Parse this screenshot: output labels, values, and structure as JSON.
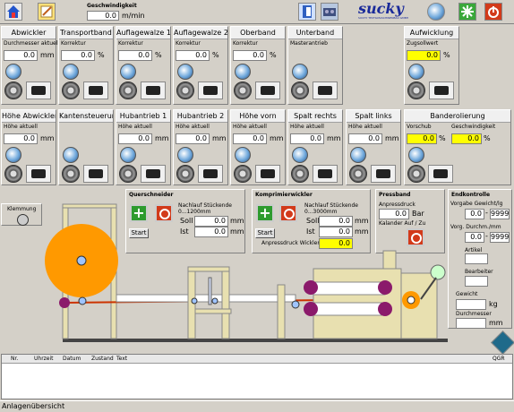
{
  "toolbar": {
    "speed_label": "Geschwindigkeit",
    "speed_value": "0.0",
    "speed_unit": "m/min",
    "logo_text": "sucky",
    "logo_sub": "SUCHY TEXTILMASCHINENBAU GMBH"
  },
  "row1": [
    {
      "title": "Abwickler",
      "sub": "Durchmesser aktuell",
      "value": "0.0",
      "unit": "mm",
      "yellow": false
    },
    {
      "title": "Transportband",
      "sub": "Korrektur",
      "value": "0.0",
      "unit": "%",
      "yellow": false
    },
    {
      "title": "Auflagewalze 1",
      "sub": "Korrektur",
      "value": "0.0",
      "unit": "%",
      "yellow": false
    },
    {
      "title": "Auflagewalze 2",
      "sub": "Korrektur",
      "value": "0.0",
      "unit": "%",
      "yellow": false
    },
    {
      "title": "Oberband",
      "sub": "Korrektur",
      "value": "0.0",
      "unit": "%",
      "yellow": false
    },
    {
      "title": "Unterband",
      "sub": "Masterantrieb",
      "value": "",
      "unit": "",
      "yellow": false
    },
    {
      "title": "Aufwicklung",
      "sub": "Zugsollwert",
      "value": "0.0",
      "unit": "%",
      "yellow": true
    }
  ],
  "row2": [
    {
      "title": "Höhe Abwickler",
      "sub": "Höhe aktuell",
      "value": "0.0",
      "unit": "mm"
    },
    {
      "title": "Kantensteuerung",
      "sub": "",
      "value": "",
      "unit": ""
    },
    {
      "title": "Hubantrieb 1",
      "sub": "Höhe aktuell",
      "value": "0.0",
      "unit": "mm"
    },
    {
      "title": "Hubantrieb 2",
      "sub": "Höhe aktuell",
      "value": "0.0",
      "unit": "mm"
    },
    {
      "title": "Höhe vorn",
      "sub": "Höhe aktuell",
      "value": "0.0",
      "unit": "mm"
    },
    {
      "title": "Spalt rechts",
      "sub": "Höhe aktuell",
      "value": "0.0",
      "unit": "mm"
    },
    {
      "title": "Spalt links",
      "sub": "Höhe aktuell",
      "value": "0.0",
      "unit": "mm"
    }
  ],
  "bandero": {
    "title": "Banderolierung",
    "vorschub_label": "Vorschub",
    "vorschub_value": "0.0",
    "vorschub_unit": "%",
    "speed_label": "Geschwindigkeit",
    "speed_value": "0.0",
    "speed_unit": "%"
  },
  "klemmung": {
    "label": "Klemmung"
  },
  "querschneider": {
    "title": "Querschneider",
    "nachlauf": "Nachlauf Stückende",
    "range": "0...1200mm",
    "soll_label": "Soll",
    "soll_value": "0.0",
    "soll_unit": "mm",
    "ist_label": "Ist",
    "ist_value": "0.0",
    "ist_unit": "mm",
    "start": "Start"
  },
  "komprimier": {
    "title": "Komprimierwickler",
    "nachlauf": "Nachlauf Stückende",
    "range": "0...3000mm",
    "soll_label": "Soll",
    "soll_value": "0.0",
    "soll_unit": "mm",
    "ist_label": "Ist",
    "ist_value": "0.0",
    "ist_unit": "mm",
    "anpress_label": "Anpressdruck Wickler",
    "anpress_value": "0.0",
    "start": "Start"
  },
  "pressband": {
    "title": "Pressband",
    "anpress_label": "Anpressdruck",
    "anpress_value": "0.0",
    "anpress_unit": "Bar",
    "kalander": "Kalander Auf / Zu"
  },
  "endkontrolle": {
    "title": "Endkontrolle",
    "vorgabe_label": "Vorgabe Gewicht/lg",
    "vorgabe_from": "0.0",
    "vorgabe_to": "9999",
    "durch_label": "Vorg. Durchm./mm",
    "durch_from": "0.0",
    "durch_to": "9999",
    "artikel": "Artikel",
    "bearbeiter": "Bearbeiter",
    "gewicht": "Gewicht",
    "gewicht_unit": "kg",
    "durchmesser": "Durchmesser",
    "durchmesser_unit": "mm"
  },
  "alarm": {
    "columns": [
      "Nr.",
      "Uhrzeit",
      "Datum",
      "Zustand",
      "Text",
      "QGR"
    ]
  },
  "status": {
    "text": "Anlagenübersicht"
  }
}
